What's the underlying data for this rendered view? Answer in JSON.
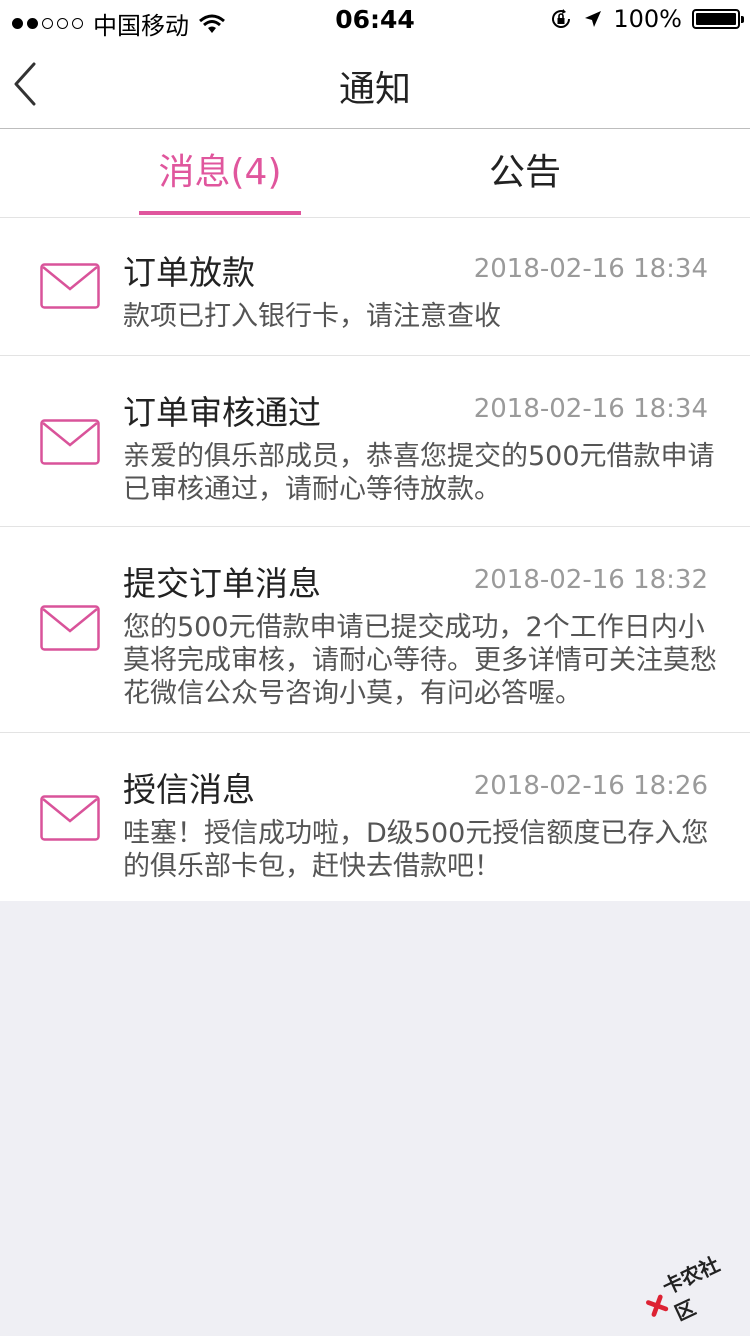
{
  "status_bar": {
    "carrier": "中国移动",
    "time": "06:44",
    "battery": "100%",
    "battery_level": 1.0
  },
  "nav": {
    "title": "通知"
  },
  "tabs": [
    {
      "label": "消息(4)",
      "active": true
    },
    {
      "label": "公告",
      "active": false
    }
  ],
  "messages": [
    {
      "title": "订单放款",
      "time": "2018-02-16 18:34",
      "body": "款项已打入银行卡，请注意查收"
    },
    {
      "title": "订单审核通过",
      "time": "2018-02-16 18:34",
      "body": "亲爱的俱乐部成员，恭喜您提交的500元借款申请已审核通过，请耐心等待放款。"
    },
    {
      "title": "提交订单消息",
      "time": "2018-02-16 18:32",
      "body": "您的500元借款申请已提交成功，2个工作日内小莫将完成审核，请耐心等待。更多详情可关注莫愁花微信公众号咨询小莫，有问必答喔。"
    },
    {
      "title": "授信消息",
      "time": "2018-02-16 18:26",
      "body": "哇塞！授信成功啦，D级500元授信额度已存入您的俱乐部卡包，赶快去借款吧！"
    }
  ],
  "watermark": "卡农社区",
  "colors": {
    "accent": "#e0569d",
    "background": "#efeff4"
  }
}
